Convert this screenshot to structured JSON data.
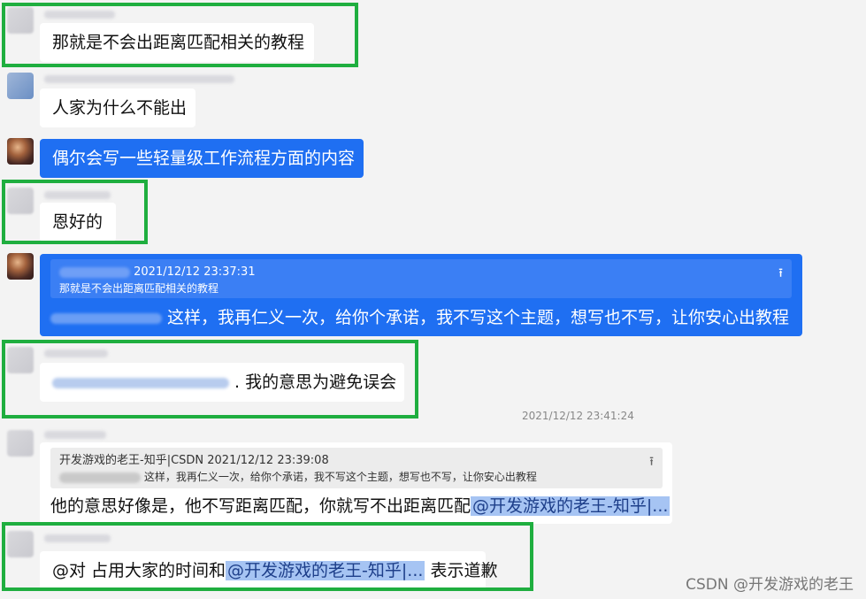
{
  "messages": {
    "m1": {
      "text": "那就是不会出距离匹配相关的教程"
    },
    "m2": {
      "text": "人家为什么不能出"
    },
    "m3": {
      "text": "偶尔会写一些轻量级工作流程方面的内容"
    },
    "m4": {
      "text": "恩好的"
    },
    "m5": {
      "quote_time": "2021/12/12 23:37:31",
      "quote_text": "那就是不会出距离匹配相关的教程",
      "text": "这样，我再仁义一次，给你个承诺，我不写这个主题，想写也不写，让你安心出教程"
    },
    "m6": {
      "text": ". 我的意思为避免误会"
    },
    "time_divider": "2021/12/12 23:41:24",
    "m7": {
      "quote_head": "开发游戏的老王-知乎|CSDN  2021/12/12 23:39:08",
      "quote_text": "这样，我再仁义一次，给你个承诺，我不写这个主题，想写也不写，让你安心出教程",
      "text": "他的意思好像是，他不写距离匹配，你就写不出距离匹配",
      "mention": "@开发游戏的老王-知乎|..."
    },
    "m8": {
      "prefix": "@对 占用大家的时间和",
      "mention": "@开发游戏的老王-知乎|...",
      "suffix": " 表示道歉"
    }
  },
  "watermark": "CSDN @开发游戏的老王",
  "colors": {
    "highlight_border": "#1fae3f",
    "self_bubble": "#1f6ff2",
    "mention_bg": "#a6c4f3"
  },
  "icons": {
    "pin": "pin-top-icon"
  }
}
